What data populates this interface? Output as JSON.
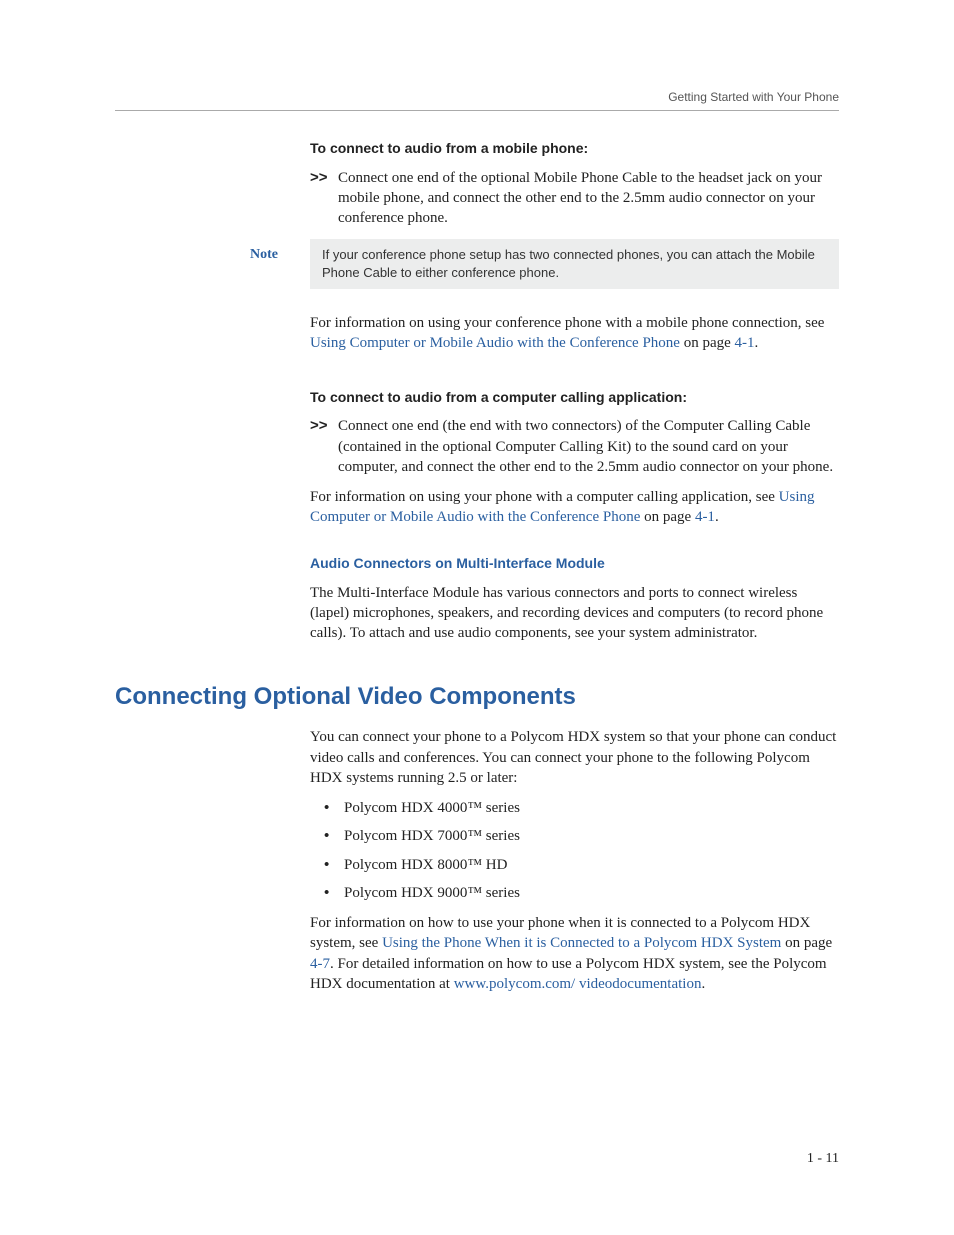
{
  "header": {
    "text": "Getting Started with Your Phone"
  },
  "sec1": {
    "title": "To connect to audio from a mobile phone:",
    "step_marker": ">>",
    "step_text": "Connect one end of the optional Mobile Phone Cable to the headset jack on your mobile phone, and connect the other end to the 2.5mm audio connector on your conference phone.",
    "note_label": "Note",
    "note_text": "If your conference phone setup has two connected phones, you can attach the Mobile Phone Cable to either conference phone.",
    "info_pre": "For information on using your conference phone with a mobile phone connection, see ",
    "info_link": "Using Computer or Mobile Audio with the Conference Phone",
    "info_mid": " on page ",
    "info_page": "4-1",
    "info_post": "."
  },
  "sec2": {
    "title": "To connect to audio from a computer calling application:",
    "step_marker": ">>",
    "step_text": "Connect one end (the end with two connectors) of the Computer Calling Cable (contained in the optional Computer Calling Kit) to the sound card on your computer, and connect the other end to the 2.5mm audio connector on your phone.",
    "info_pre": "For information on using your phone with a computer calling application, see ",
    "info_link": "Using Computer or Mobile Audio with the Conference Phone",
    "info_mid": " on page ",
    "info_page": "4-1",
    "info_post": "."
  },
  "sec3": {
    "title": "Audio Connectors on Multi-Interface Module",
    "body": "The Multi-Interface Module has various connectors and ports to connect wireless (lapel) microphones, speakers, and recording devices and computers (to record phone calls). To attach and use audio components, see your system administrator."
  },
  "sec4": {
    "title": "Connecting Optional Video Components",
    "intro": "You can connect your phone to a Polycom HDX system so that your phone can conduct video calls and conferences. You can connect your phone to the following Polycom HDX systems running 2.5 or later:",
    "items": [
      "Polycom HDX 4000™ series",
      "Polycom HDX 7000™ series",
      "Polycom HDX 8000™ HD",
      "Polycom HDX 9000™ series"
    ],
    "out_pre": "For information on how to use your phone when it is connected to a Polycom HDX system, see ",
    "out_link1": "Using the Phone When it is Connected to a Polycom HDX System",
    "out_mid1": " on page ",
    "out_page": "4-7",
    "out_mid2": ". For detailed information on how to use a Polycom HDX system, see the Polycom HDX documentation at ",
    "out_link2": "www.polycom.com/ videodocumentation",
    "out_post": "."
  },
  "page_number": "1 - 11"
}
